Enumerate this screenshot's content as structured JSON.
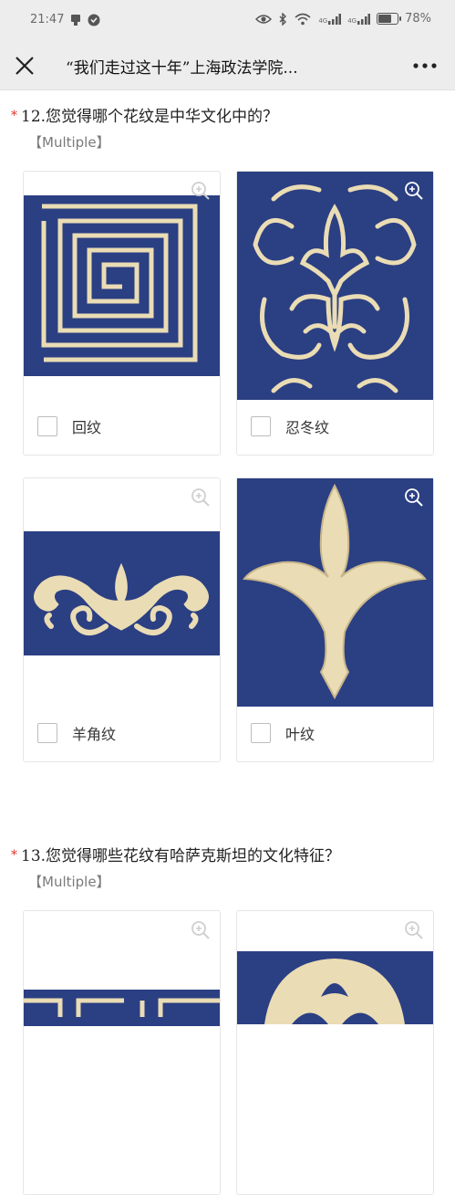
{
  "status_bar": {
    "time": "21:47",
    "battery_percent": "78%",
    "battery_level": 0.78,
    "network_labels": [
      "4G",
      "4G"
    ]
  },
  "nav": {
    "title": "“我们走过这十年”上海政法学院...",
    "close_icon": "close-icon",
    "more_icon": "more-icon"
  },
  "questions": [
    {
      "number_title": "12.您觉得哪个花纹是中华文化中的？",
      "tag": "【Multiple】",
      "options": [
        {
          "label": "回纹",
          "pattern": "hui-pattern"
        },
        {
          "label": "忍冬纹",
          "pattern": "rendong-pattern"
        },
        {
          "label": "羊角纹",
          "pattern": "ram-horn-pattern"
        },
        {
          "label": "叶纹",
          "pattern": "leaf-pattern"
        }
      ]
    },
    {
      "number_title": "13.您觉得哪些花纹有哈萨克斯坦的文化特征？",
      "tag": "【Multiple】",
      "options": [
        {
          "label": "",
          "pattern": "border-pattern"
        },
        {
          "label": "",
          "pattern": "circle-pattern"
        }
      ]
    }
  ],
  "colors": {
    "pattern_bg": "#2b3f83",
    "pattern_fg": "#eadcb4",
    "required_star": "#e0342c",
    "bar_bg": "#ededed"
  }
}
